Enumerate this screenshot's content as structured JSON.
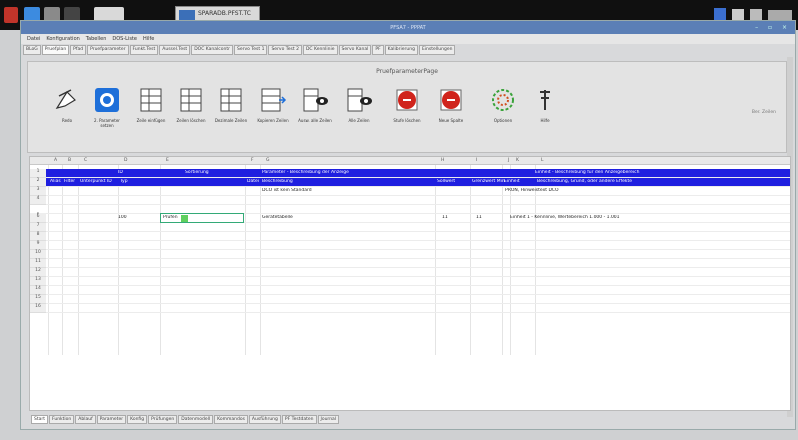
{
  "os": {
    "task_label": "SPARADB.PFST.TC"
  },
  "window": {
    "title": "PFSA7 - PPPAT",
    "menu": [
      "Datei",
      "Konfiguration",
      "Tabellen",
      "DOS-Liste",
      "Hilfe"
    ],
    "tabs": [
      "BLoG",
      "Pruefplan",
      "Pfad",
      "Pruefparameter",
      "Funkt.Test",
      "Aussel.Test",
      "DOC Kanalcontr",
      "Servo Test 1",
      "Servo Test 2",
      "DC Kennlinie",
      "Servo Kanal",
      "PF",
      "Kalibrierung",
      "Einstellungen"
    ]
  },
  "ribbon": {
    "title": "PruefparameterPage",
    "right_text": "Ber. Zeilen",
    "tools": [
      {
        "label": "Redo",
        "icon": "redo-icon"
      },
      {
        "label": "2. Parameter setzen",
        "icon": "parameter-icon"
      },
      {
        "label": "Zeile einfügen",
        "icon": "insert-row-icon"
      },
      {
        "label": "Zeilen löschen",
        "icon": "delete-rows-icon"
      },
      {
        "label": "Dezimale Zeilen",
        "icon": "decimal-rows-icon"
      },
      {
        "label": "Kopieren Zeilen",
        "icon": "copy-rows-icon"
      },
      {
        "label": "Ausw. alle Zeilen",
        "icon": "select-all-rows-icon"
      },
      {
        "label": "Alle Zeilen",
        "icon": "all-rows-icon"
      },
      {
        "label": "Stufe löschen",
        "icon": "delete-step-icon"
      },
      {
        "label": "Neue Spalte",
        "icon": "new-column-icon"
      },
      {
        "label": "Optionen",
        "icon": "options-icon"
      },
      {
        "label": "Hilfe",
        "icon": "help-icon"
      }
    ]
  },
  "sheet": {
    "columns": [
      "A",
      "B",
      "C",
      "D",
      "E",
      "F",
      "G",
      "H",
      "I",
      "J",
      "K",
      "L"
    ],
    "row_numbers": [
      "1",
      "2",
      "3",
      "4",
      "5",
      "6",
      "7",
      "8",
      "9",
      "10",
      "11",
      "12",
      "13",
      "14",
      "15",
      "16"
    ],
    "row1": {
      "c3": "ID",
      "c4": "Sortierung",
      "c6": "Parameter - Beschreibung der Anzeige",
      "c11": "Einheit - Beschreibung für den Anzeigebereich"
    },
    "row2": [
      "Alias",
      "Filter",
      "Unterpunkt ID",
      "Typ",
      "Datei",
      "Beschreibung",
      "Sollwert",
      "Grenzwert Min",
      "Einheit",
      "Beschreibung, Grund, oder andere Effekte"
    ],
    "row3": {
      "c6": "DCO ist kein Standard",
      "c11": "PRON, Hinweistext DCO"
    },
    "row5": {
      "c3": "100",
      "c4": "Prüfen",
      "c6": "Gerätetabelle",
      "c8": "11",
      "c9": "11",
      "c11": "Einheit 1 - Kennlinie, Wertebereich 1.000 - 1.001"
    }
  },
  "sheet_tabs": [
    "Start",
    "Funktion",
    "Ablauf",
    "Parameter",
    "Konfig",
    "Prüfungen",
    "Datenmodell",
    "Kommandos",
    "Ausführung",
    "PF Testdaten",
    "Journal"
  ]
}
